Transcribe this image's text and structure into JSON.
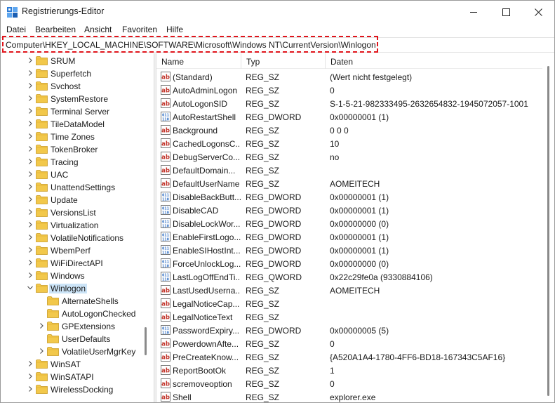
{
  "window": {
    "title": "Registrierungs-Editor"
  },
  "menu": [
    "Datei",
    "Bearbeiten",
    "Ansicht",
    "Favoriten",
    "Hilfe"
  ],
  "address": {
    "path": "Computer\\HKEY_LOCAL_MACHINE\\SOFTWARE\\Microsoft\\Windows NT\\CurrentVersion\\Winlogon"
  },
  "tree": {
    "items": [
      {
        "label": "SRUM",
        "level": 0,
        "expandable": true,
        "selected": false
      },
      {
        "label": "Superfetch",
        "level": 0,
        "expandable": true,
        "selected": false
      },
      {
        "label": "Svchost",
        "level": 0,
        "expandable": true,
        "selected": false
      },
      {
        "label": "SystemRestore",
        "level": 0,
        "expandable": true,
        "selected": false
      },
      {
        "label": "Terminal Server",
        "level": 0,
        "expandable": true,
        "selected": false
      },
      {
        "label": "TileDataModel",
        "level": 0,
        "expandable": true,
        "selected": false
      },
      {
        "label": "Time Zones",
        "level": 0,
        "expandable": true,
        "selected": false
      },
      {
        "label": "TokenBroker",
        "level": 0,
        "expandable": true,
        "selected": false
      },
      {
        "label": "Tracing",
        "level": 0,
        "expandable": true,
        "selected": false
      },
      {
        "label": "UAC",
        "level": 0,
        "expandable": true,
        "selected": false
      },
      {
        "label": "UnattendSettings",
        "level": 0,
        "expandable": true,
        "selected": false
      },
      {
        "label": "Update",
        "level": 0,
        "expandable": true,
        "selected": false
      },
      {
        "label": "VersionsList",
        "level": 0,
        "expandable": true,
        "selected": false
      },
      {
        "label": "Virtualization",
        "level": 0,
        "expandable": true,
        "selected": false
      },
      {
        "label": "VolatileNotifications",
        "level": 0,
        "expandable": true,
        "selected": false
      },
      {
        "label": "WbemPerf",
        "level": 0,
        "expandable": true,
        "selected": false
      },
      {
        "label": "WiFiDirectAPI",
        "level": 0,
        "expandable": true,
        "selected": false
      },
      {
        "label": "Windows",
        "level": 0,
        "expandable": true,
        "selected": false
      },
      {
        "label": "Winlogon",
        "level": 0,
        "expandable": true,
        "expanded": true,
        "selected": true
      },
      {
        "label": "AlternateShells",
        "level": 1,
        "expandable": false,
        "selected": false
      },
      {
        "label": "AutoLogonChecked",
        "level": 1,
        "expandable": false,
        "selected": false
      },
      {
        "label": "GPExtensions",
        "level": 1,
        "expandable": true,
        "selected": false
      },
      {
        "label": "UserDefaults",
        "level": 1,
        "expandable": false,
        "selected": false
      },
      {
        "label": "VolatileUserMgrKey",
        "level": 1,
        "expandable": true,
        "selected": false
      },
      {
        "label": "WinSAT",
        "level": 0,
        "expandable": true,
        "selected": false
      },
      {
        "label": "WinSATAPI",
        "level": 0,
        "expandable": true,
        "selected": false
      },
      {
        "label": "WirelessDocking",
        "level": 0,
        "expandable": true,
        "selected": false
      }
    ]
  },
  "list": {
    "columns": [
      "Name",
      "Typ",
      "Daten"
    ],
    "rows": [
      {
        "name": "(Standard)",
        "type": "REG_SZ",
        "data": "(Wert nicht festgelegt)",
        "icon": "string-value-icon"
      },
      {
        "name": "AutoAdminLogon",
        "type": "REG_SZ",
        "data": "0",
        "icon": "string-value-icon"
      },
      {
        "name": "AutoLogonSID",
        "type": "REG_SZ",
        "data": "S-1-5-21-982333495-2632654832-1945072057-1001",
        "icon": "string-value-icon"
      },
      {
        "name": "AutoRestartShell",
        "type": "REG_DWORD",
        "data": "0x00000001 (1)",
        "icon": "binary-value-icon"
      },
      {
        "name": "Background",
        "type": "REG_SZ",
        "data": "0 0 0",
        "icon": "string-value-icon"
      },
      {
        "name": "CachedLogonsC...",
        "type": "REG_SZ",
        "data": "10",
        "icon": "string-value-icon"
      },
      {
        "name": "DebugServerCo...",
        "type": "REG_SZ",
        "data": "no",
        "icon": "string-value-icon"
      },
      {
        "name": "DefaultDomain...",
        "type": "REG_SZ",
        "data": "",
        "icon": "string-value-icon"
      },
      {
        "name": "DefaultUserName",
        "type": "REG_SZ",
        "data": "AOMEITECH",
        "icon": "string-value-icon"
      },
      {
        "name": "DisableBackButt...",
        "type": "REG_DWORD",
        "data": "0x00000001 (1)",
        "icon": "binary-value-icon"
      },
      {
        "name": "DisableCAD",
        "type": "REG_DWORD",
        "data": "0x00000001 (1)",
        "icon": "binary-value-icon"
      },
      {
        "name": "DisableLockWor...",
        "type": "REG_DWORD",
        "data": "0x00000000 (0)",
        "icon": "binary-value-icon"
      },
      {
        "name": "EnableFirstLogo...",
        "type": "REG_DWORD",
        "data": "0x00000001 (1)",
        "icon": "binary-value-icon"
      },
      {
        "name": "EnableSIHostInt...",
        "type": "REG_DWORD",
        "data": "0x00000001 (1)",
        "icon": "binary-value-icon"
      },
      {
        "name": "ForceUnlockLog...",
        "type": "REG_DWORD",
        "data": "0x00000000 (0)",
        "icon": "binary-value-icon"
      },
      {
        "name": "LastLogOffEndTi...",
        "type": "REG_QWORD",
        "data": "0x22c29fe0a (9330884106)",
        "icon": "binary-value-icon"
      },
      {
        "name": "LastUsedUserna...",
        "type": "REG_SZ",
        "data": "AOMEITECH",
        "icon": "string-value-icon"
      },
      {
        "name": "LegalNoticeCap...",
        "type": "REG_SZ",
        "data": "",
        "icon": "string-value-icon"
      },
      {
        "name": "LegalNoticeText",
        "type": "REG_SZ",
        "data": "",
        "icon": "string-value-icon"
      },
      {
        "name": "PasswordExpiry...",
        "type": "REG_DWORD",
        "data": "0x00000005 (5)",
        "icon": "binary-value-icon"
      },
      {
        "name": "PowerdownAfte...",
        "type": "REG_SZ",
        "data": "0",
        "icon": "string-value-icon"
      },
      {
        "name": "PreCreateKnow...",
        "type": "REG_SZ",
        "data": "{A520A1A4-1780-4FF6-BD18-167343C5AF16}",
        "icon": "string-value-icon"
      },
      {
        "name": "ReportBootOk",
        "type": "REG_SZ",
        "data": "1",
        "icon": "string-value-icon"
      },
      {
        "name": "scremoveoption",
        "type": "REG_SZ",
        "data": "0",
        "icon": "string-value-icon"
      },
      {
        "name": "Shell",
        "type": "REG_SZ",
        "data": "explorer.exe",
        "icon": "string-value-icon"
      }
    ]
  },
  "colors": {
    "highlight_border": "#e0141b",
    "selection": "#cce4f7",
    "folder": "#f2c84b",
    "string_icon": "#c2352b",
    "binary_icon": "#2f6fc4"
  }
}
